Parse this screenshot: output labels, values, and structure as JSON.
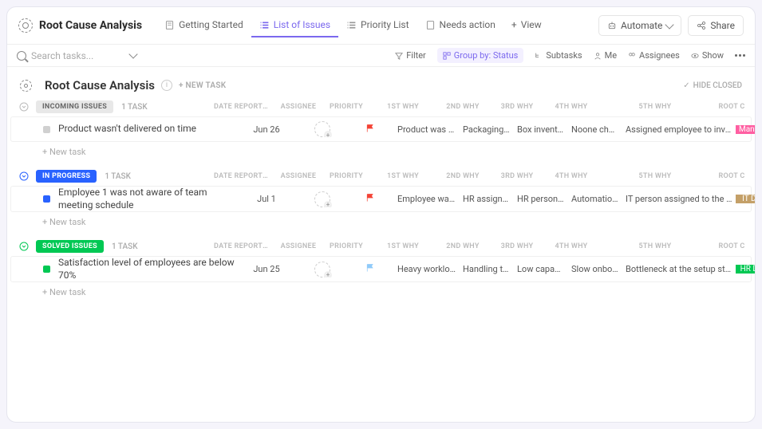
{
  "header": {
    "title": "Root Cause Analysis",
    "tabs": [
      {
        "label": "Getting Started"
      },
      {
        "label": "List of Issues"
      },
      {
        "label": "Priority List"
      },
      {
        "label": "Needs action"
      }
    ],
    "view_btn": "View",
    "automate_btn": "Automate",
    "share_btn": "Share"
  },
  "toolbar": {
    "search_placeholder": "Search tasks...",
    "filter": "Filter",
    "group_by": "Group by: Status",
    "subtasks": "Subtasks",
    "me": "Me",
    "assignees": "Assignees",
    "show": "Show"
  },
  "page": {
    "folder_title": "Root Cause Analysis",
    "new_task": "+ NEW TASK",
    "hide_closed": "HIDE CLOSED"
  },
  "columns": {
    "date": "DATE REPORTED",
    "assignee": "ASSIGNEE",
    "priority": "PRIORITY",
    "why1": "1ST WHY",
    "why2": "2ND WHY",
    "why3": "3RD WHY",
    "why4": "4TH WHY",
    "why5": "5TH WHY",
    "root": "ROOT C"
  },
  "groups": [
    {
      "status": "INCOMING ISSUES",
      "pill_class": "pill-gray",
      "sq_class": "sq-gray",
      "count": "1 TASK",
      "tasks": [
        {
          "name": "Product wasn't delivered on time",
          "date": "Jun 26",
          "flag": "#f44336",
          "why1": "Product was not re...",
          "why2": "Packaging wa...",
          "why3": "Box inventory...",
          "why4": "Noone check...",
          "why5": "Assigned employee to inventory che...",
          "root": "Manpo",
          "tag_class": "tag-cell"
        }
      ]
    },
    {
      "status": "IN PROGRESS",
      "pill_class": "pill-blue",
      "sq_class": "sq-blue",
      "count": "1 TASK",
      "tasks": [
        {
          "name": "Employee 1 was not aware of team meeting schedule",
          "date": "Jul 1",
          "flag": "#f44336",
          "why1": "Employee was not ...",
          "why2": "HR assigned t...",
          "why3": "HR person ti...",
          "why4": "Automation f...",
          "why5": "IT person assigned to the automatio...",
          "root": "IT Depa",
          "tag_class": "tag-brown"
        }
      ]
    },
    {
      "status": "SOLVED ISSUES",
      "pill_class": "pill-green",
      "sq_class": "sq-green",
      "count": "1 TASK",
      "tasks": [
        {
          "name": "Satisfaction level of employees are below 70%",
          "date": "Jun 25",
          "flag": "#90caf9",
          "why1": "Heavy workload",
          "why2": "Handling too ...",
          "why3": "Low capacity ...",
          "why4": "Slow onboard...",
          "why5": "Bottleneck at the setup stage of onb...",
          "root": "HR Depa",
          "tag_class": "tag-green"
        }
      ]
    }
  ],
  "add_task": "+ New task"
}
